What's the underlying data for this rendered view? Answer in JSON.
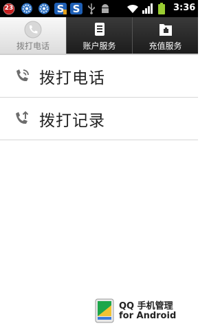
{
  "status_bar": {
    "notification_badge": "23",
    "time": "3:36",
    "icons": [
      "calendar-notification-icon",
      "settings-app-icon",
      "settings-app-icon",
      "s-app-icon",
      "s-app-icon",
      "usb-icon",
      "android-debug-icon",
      "wifi-icon",
      "signal-icon",
      "battery-icon"
    ],
    "accent_green": "#9acd32"
  },
  "tabs": [
    {
      "label": "拨打电话",
      "icon": "phone-handset-icon",
      "selected": true
    },
    {
      "label": "账户服务",
      "icon": "document-icon",
      "selected": false
    },
    {
      "label": "充值服务",
      "icon": "recharge-card-icon",
      "selected": false
    }
  ],
  "menu": [
    {
      "label": "拨打电话",
      "icon": "phone-call-icon"
    },
    {
      "label": "拨打记录",
      "icon": "call-log-icon"
    }
  ],
  "footer": {
    "line1": "QQ 手机管理",
    "line2": "for Android"
  }
}
